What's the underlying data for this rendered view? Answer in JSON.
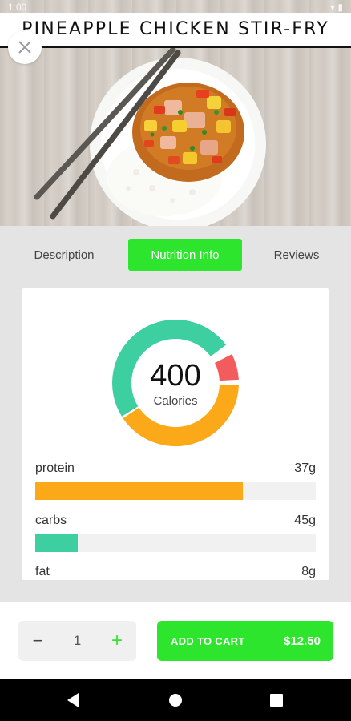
{
  "status_bar": {
    "left": "1:00",
    "right": "▾ ▮"
  },
  "recipe": {
    "title": "PINEAPPLE CHICKEN STIR-FRY"
  },
  "tabs": [
    {
      "label": "Description",
      "active": false
    },
    {
      "label": "Nutrition Info",
      "active": true
    },
    {
      "label": "Reviews",
      "active": false
    }
  ],
  "nutrition": {
    "calories_value": "400",
    "calories_label": "Calories",
    "nutrients": [
      {
        "name": "protein",
        "amount": "37g",
        "fraction": 0.74,
        "color": "#fba919"
      },
      {
        "name": "carbs",
        "amount": "45g",
        "fraction": 0.15,
        "color": "#3dcf9f"
      },
      {
        "name": "fat",
        "amount": "8g",
        "fraction": 0.0,
        "color": "#f25c5c"
      }
    ]
  },
  "cart": {
    "quantity": "1",
    "add_label": "ADD TO CART",
    "price": "$12.50"
  },
  "colors": {
    "accent": "#2ee52e",
    "protein": "#fba919",
    "carbs": "#3dcf9f",
    "fat": "#f25c5c"
  },
  "icons": {
    "close": "close-icon",
    "back": "back-icon",
    "home": "home-icon",
    "recents": "recents-icon"
  }
}
